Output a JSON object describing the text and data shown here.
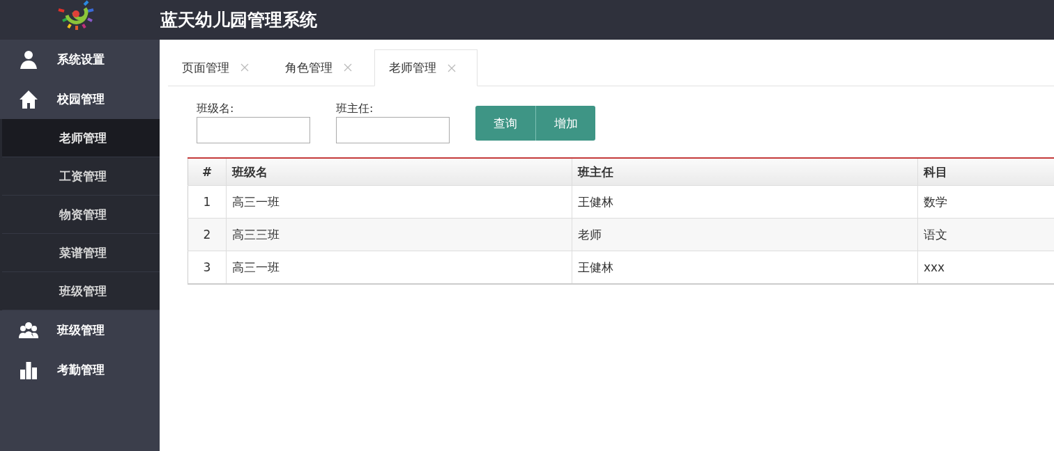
{
  "header": {
    "title": "蓝天幼儿园管理系统"
  },
  "sidebar": {
    "items": [
      {
        "label": "系统设置",
        "kind": "person"
      },
      {
        "label": "校园管理",
        "kind": "house",
        "children": [
          {
            "label": "老师管理",
            "selected": true
          },
          {
            "label": "工资管理",
            "selected": false
          },
          {
            "label": "物资管理",
            "selected": false
          },
          {
            "label": "菜谱管理",
            "selected": false
          },
          {
            "label": "班级管理",
            "selected": false
          }
        ]
      },
      {
        "label": "班级管理",
        "kind": "group"
      },
      {
        "label": "考勤管理",
        "kind": "chart"
      }
    ]
  },
  "tabs": [
    {
      "label": "页面管理",
      "selected": false
    },
    {
      "label": "角色管理",
      "selected": false
    },
    {
      "label": "老师管理",
      "selected": true
    }
  ],
  "filters": [
    {
      "label": "班级名:"
    },
    {
      "label": "班主任:"
    }
  ],
  "buttons": [
    "查询",
    "增加"
  ],
  "table": {
    "columns": [
      "#",
      "班级名",
      "班主任",
      "科目"
    ],
    "rows": [
      [
        "1",
        "高三一班",
        "王健林",
        "数学"
      ],
      [
        "2",
        "高三三班",
        "老师",
        "语文"
      ],
      [
        "3",
        "高三一班",
        "王健林",
        "xxx"
      ]
    ]
  }
}
